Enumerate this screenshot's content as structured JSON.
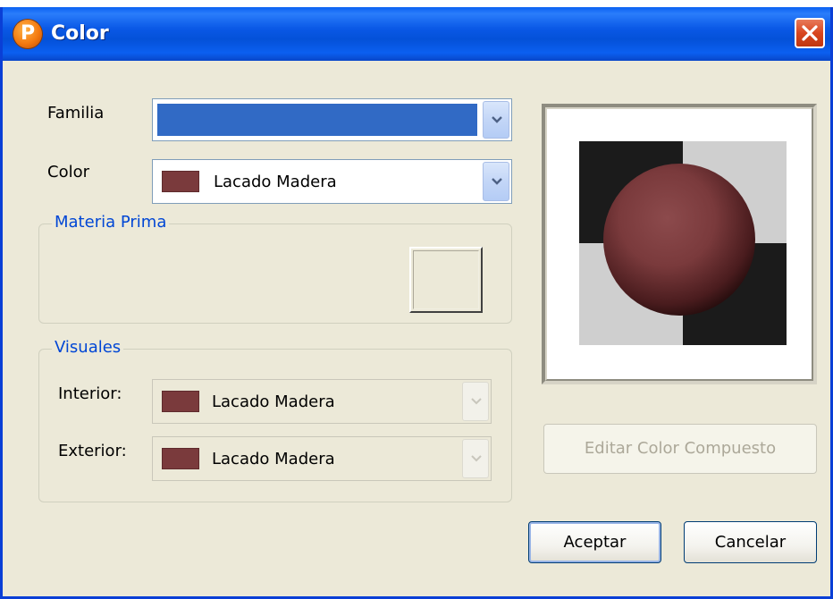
{
  "window": {
    "title": "Color",
    "app_icon_letter": "P"
  },
  "form": {
    "familia": {
      "label": "Familia",
      "selected": ""
    },
    "color": {
      "label": "Color",
      "selected": "Lacado Madera",
      "swatch": "#7a3a3c"
    }
  },
  "materia_prima": {
    "legend": "Materia Prima"
  },
  "visuales": {
    "legend": "Visuales",
    "interior": {
      "label": "Interior:",
      "selected": "Lacado Madera",
      "swatch": "#7a3a3c"
    },
    "exterior": {
      "label": "Exterior:",
      "selected": "Lacado Madera",
      "swatch": "#7a3a3c"
    }
  },
  "buttons": {
    "editar": "Editar Color Compuesto",
    "aceptar": "Aceptar",
    "cancelar": "Cancelar"
  },
  "colors": {
    "titlebar": "#0a58e6",
    "dialog_bg": "#ece9d8",
    "group_legend": "#0046d5",
    "familia_selection": "#316ac5",
    "material_color": "#7a3a3c",
    "close_button": "#d8461f"
  },
  "icons": {
    "app": "app-logo-icon",
    "close": "close-icon",
    "dropdown": "chevron-down-icon"
  }
}
